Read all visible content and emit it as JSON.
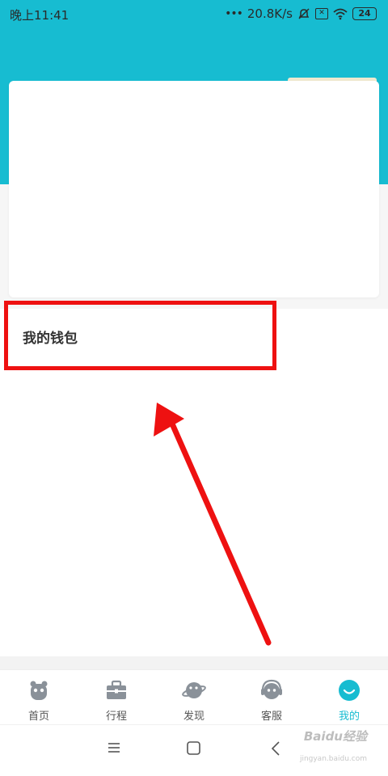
{
  "status_bar": {
    "time": "晚上11:41",
    "dots": "•••",
    "speed": "20.8K/s",
    "battery": "24"
  },
  "wallet": {
    "label": "我的钱包"
  },
  "tabs": [
    {
      "label": "首页",
      "icon": "home-icon",
      "active": false
    },
    {
      "label": "行程",
      "icon": "briefcase-icon",
      "active": false
    },
    {
      "label": "发现",
      "icon": "planet-icon",
      "active": false
    },
    {
      "label": "客服",
      "icon": "headset-icon",
      "active": false
    },
    {
      "label": "我的",
      "icon": "smile-icon",
      "active": true
    }
  ],
  "watermark": {
    "text": "Baidu经验",
    "sub": "jingyan.baidu.com"
  },
  "colors": {
    "header": "#17bcd1",
    "accent": "#17bcd1",
    "highlight": "#ee1111",
    "tab_icon": "#8a9199"
  }
}
